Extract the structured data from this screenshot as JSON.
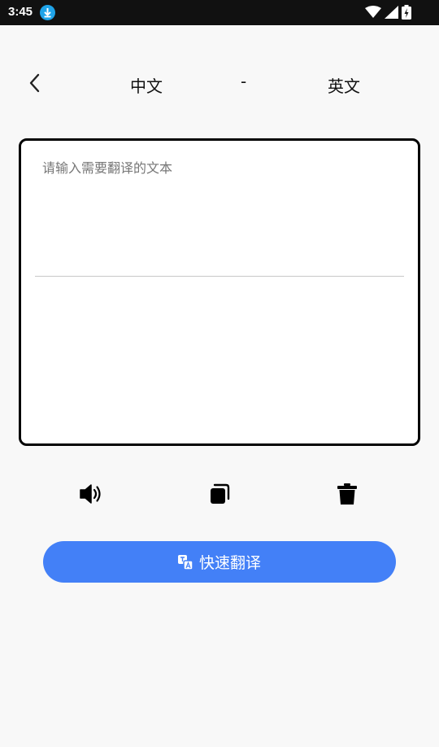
{
  "status_bar": {
    "time": "3:45",
    "icons": [
      "download-icon",
      "wifi-icon",
      "signal-icon",
      "battery-icon"
    ]
  },
  "header": {
    "source_language": "中文",
    "separator": "-",
    "target_language": "英文"
  },
  "input": {
    "placeholder": "请输入需要翻译的文本",
    "value": ""
  },
  "tools": [
    "speaker-icon",
    "copy-icon",
    "trash-icon"
  ],
  "translate_button": {
    "label": "快速翻译",
    "icon": "translate-icon"
  },
  "colors": {
    "accent": "#4380f7",
    "status_bar": "#111111",
    "background": "#f8f8f8"
  }
}
